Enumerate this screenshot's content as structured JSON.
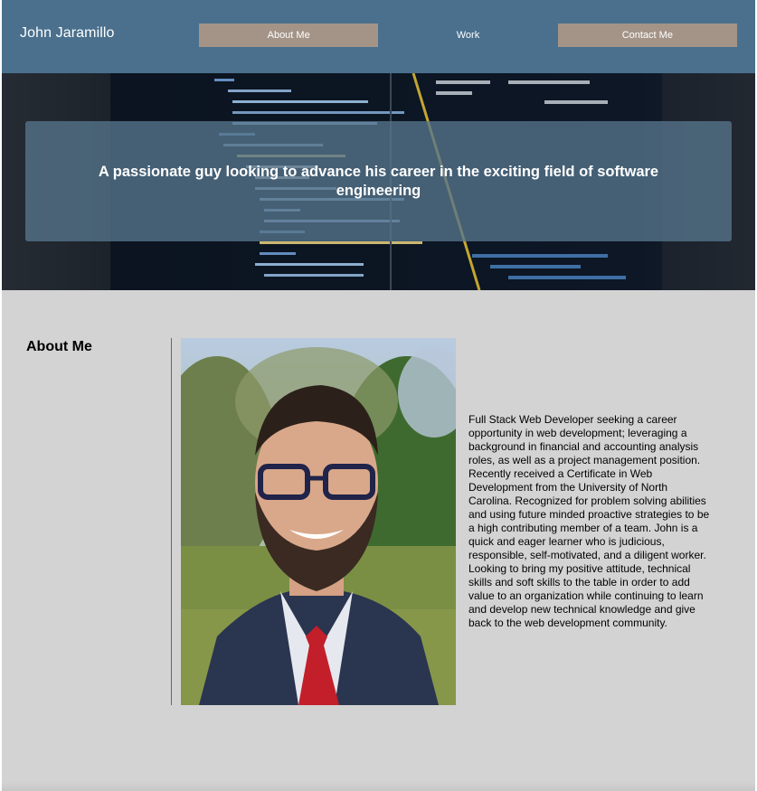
{
  "header": {
    "brand": "John Jaramillo",
    "nav": [
      {
        "label": "About Me"
      },
      {
        "label": "Work"
      },
      {
        "label": "Contact Me"
      }
    ]
  },
  "hero": {
    "tagline": "A passionate guy looking to advance his career in the exciting field of software engineering"
  },
  "about": {
    "title": "About Me",
    "bio": "Full Stack Web Developer seeking a career opportunity in web development; leveraging a background in financial and accounting analysis roles, as well as a project management position. Recently received a Certificate in Web Development from the University of North Carolina. Recognized for problem solving abilities and using future minded proactive strategies to be a high contributing member of a team. John is a quick and eager learner who is judicious, responsible, self-motivated, and a diligent worker. Looking to bring my positive attitude, technical skills and soft skills to the table in order to add value to an organization while continuing to learn and develop new technical knowledge and give back to the web development community."
  },
  "colors": {
    "header_bg": "#4a708d",
    "nav_bg": "#a39487",
    "section_bg": "#d3d3d3"
  }
}
